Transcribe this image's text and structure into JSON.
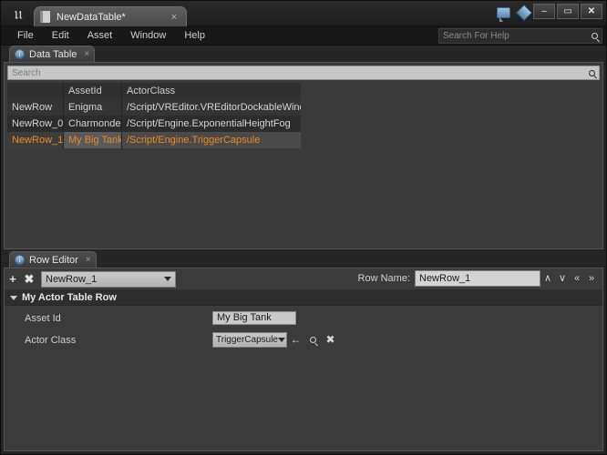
{
  "window": {
    "logo": "ue-logo",
    "document_tab": {
      "label": "NewDataTable*",
      "close": "×"
    },
    "top_icons": [
      {
        "name": "feedback-icon"
      },
      {
        "name": "source-control-icon"
      }
    ],
    "controls": {
      "minimize": "–",
      "restore": "▭",
      "close": "✕"
    }
  },
  "menubar": {
    "items": [
      {
        "label": "File"
      },
      {
        "label": "Edit"
      },
      {
        "label": "Asset"
      },
      {
        "label": "Window"
      },
      {
        "label": "Help"
      }
    ],
    "help_search": {
      "placeholder": "Search For Help",
      "value": ""
    }
  },
  "data_table_panel": {
    "tab": {
      "label": "Data Table",
      "icon": "i",
      "close": "×"
    },
    "search": {
      "placeholder": "Search",
      "value": ""
    },
    "columns": [
      "",
      "AssetId",
      "ActorClass"
    ],
    "rows": [
      {
        "name": "NewRow",
        "asset_id": "Enigma",
        "actor_class": "/Script/VREditor.VREditorDockableWindow",
        "selected": false
      },
      {
        "name": "NewRow_0",
        "asset_id": "Charmonder",
        "actor_class": "/Script/Engine.ExponentialHeightFog",
        "selected": false
      },
      {
        "name": "NewRow_1",
        "asset_id": "My Big Tank",
        "actor_class": "/Script/Engine.TriggerCapsule",
        "selected": true
      }
    ]
  },
  "row_editor_panel": {
    "tab": {
      "label": "Row Editor",
      "icon": "i",
      "close": "×"
    },
    "toolbar": {
      "add_label": "+",
      "remove_label": "✖",
      "row_select_value": "NewRow_1",
      "row_name_label": "Row Name:",
      "row_name_value": "NewRow_1",
      "nav": [
        {
          "name": "move-up-icon",
          "glyph": "∧"
        },
        {
          "name": "move-down-icon",
          "glyph": "∨"
        },
        {
          "name": "move-top-icon",
          "glyph": "«"
        },
        {
          "name": "move-bottom-icon",
          "glyph": "»"
        }
      ]
    },
    "category": {
      "label": "My Actor Table Row",
      "expanded": true
    },
    "properties": [
      {
        "label": "Asset Id",
        "type": "text",
        "value": "My Big Tank"
      },
      {
        "label": "Actor Class",
        "type": "class",
        "value": "TriggerCapsule",
        "actions": [
          {
            "name": "use-selected-icon",
            "glyph": "←"
          },
          {
            "name": "browse-icon",
            "glyph": "mag"
          },
          {
            "name": "clear-icon",
            "glyph": "✖"
          }
        ]
      }
    ]
  },
  "colors": {
    "accent_orange": "#f08a1e",
    "panel_bg": "#3a3a3a",
    "window_bg": "#262626",
    "input_light": "#c9c9c9"
  }
}
